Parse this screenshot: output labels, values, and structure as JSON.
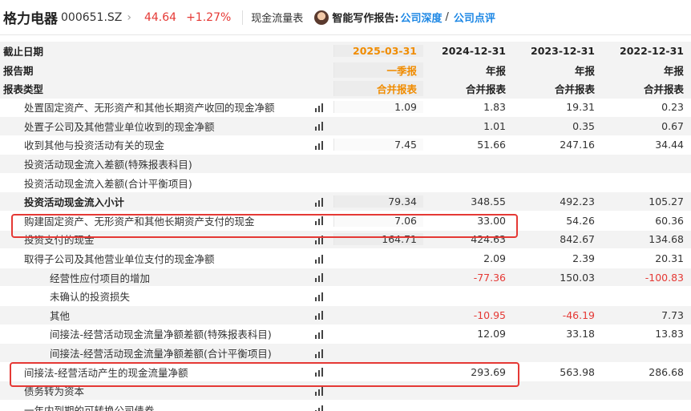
{
  "header": {
    "stock_name": "格力电器",
    "stock_code": "000651.SZ",
    "chevron": "›",
    "price": "44.64",
    "change": "+1.27%",
    "section_label": "现金流量表",
    "report_label": "智能写作报告:",
    "link_depth": "公司深度",
    "slash": "/",
    "link_review": "公司点评"
  },
  "table_header": [
    {
      "label": "截止日期",
      "values": [
        "2025-03-31",
        "2024-12-31",
        "2023-12-31",
        "2022-12-31"
      ]
    },
    {
      "label": "报告期",
      "values": [
        "一季报",
        "年报",
        "年报",
        "年报"
      ]
    },
    {
      "label": "报表类型",
      "values": [
        "合并报表",
        "合并报表",
        "合并报表",
        "合并报表"
      ]
    }
  ],
  "rows": [
    {
      "label": "处置固定资产、无形资产和其他长期资产收回的现金净额",
      "values": [
        "1.09",
        "1.83",
        "19.31",
        "0.23"
      ]
    },
    {
      "label": "处置子公司及其他营业单位收到的现金净额",
      "values": [
        "",
        "1.01",
        "0.35",
        "0.67"
      ]
    },
    {
      "label": "收到其他与投资活动有关的现金",
      "values": [
        "7.45",
        "51.66",
        "247.16",
        "34.44"
      ]
    },
    {
      "label": "投资活动现金流入差额(特殊报表科目)",
      "values": [
        "",
        "",
        "",
        ""
      ]
    },
    {
      "label": "投资活动现金流入差额(合计平衡项目)",
      "values": [
        "",
        "",
        "",
        ""
      ]
    },
    {
      "label": "投资活动现金流入小计",
      "values": [
        "79.34",
        "348.55",
        "492.23",
        "105.27"
      ]
    },
    {
      "label": "购建固定资产、无形资产和其他长期资产支付的现金",
      "values": [
        "7.06",
        "33.00",
        "54.26",
        "60.36"
      ]
    },
    {
      "label": "投资支付的现金",
      "values": [
        "164.71",
        "424.63",
        "842.67",
        "134.68"
      ]
    },
    {
      "label": "取得子公司及其他营业单位支付的现金净额",
      "values": [
        "",
        "2.09",
        "2.39",
        "20.31"
      ]
    },
    {
      "label": "经营性应付项目的增加",
      "values": [
        "",
        "-77.36",
        "150.03",
        "-100.83"
      ]
    },
    {
      "label": "未确认的投资损失",
      "values": [
        "",
        "",
        "",
        ""
      ]
    },
    {
      "label": "其他",
      "values": [
        "",
        "-10.95",
        "-46.19",
        "7.73"
      ]
    },
    {
      "label": "间接法-经营活动现金流量净额差额(特殊报表科目)",
      "values": [
        "",
        "12.09",
        "33.18",
        "13.83"
      ]
    },
    {
      "label": "间接法-经营活动现金流量净额差额(合计平衡项目)",
      "values": [
        "",
        "",
        "",
        ""
      ]
    },
    {
      "label": "间接法-经营活动产生的现金流量净额",
      "values": [
        "",
        "293.69",
        "563.98",
        "286.68"
      ]
    },
    {
      "label": "债务转为资本",
      "values": [
        "",
        "",
        "",
        ""
      ]
    },
    {
      "label": "一年内到期的可转换公司债券",
      "values": [
        "",
        "",
        "",
        ""
      ]
    }
  ],
  "highlight_color": "#e53935",
  "accent_color": "#f08c00",
  "negative_color": "#e53935"
}
